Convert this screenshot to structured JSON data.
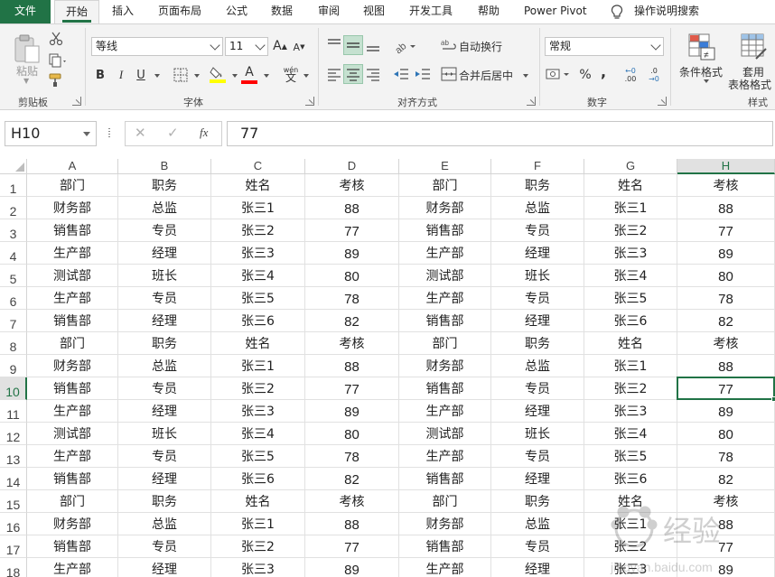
{
  "menu": {
    "tabs": [
      "文件",
      "开始",
      "插入",
      "页面布局",
      "公式",
      "数据",
      "审阅",
      "视图",
      "开发工具",
      "帮助",
      "Power Pivot"
    ],
    "search_label": "操作说明搜索",
    "active_tab": "开始"
  },
  "ribbon": {
    "clipboard": {
      "paste_label": "粘贴",
      "group_label": "剪贴板"
    },
    "font": {
      "font_name": "等线",
      "font_size": "11",
      "bold": "B",
      "italic": "I",
      "underline": "U",
      "font_color_glyph": "A",
      "phonetic_glyph": "wén",
      "phonetic_char": "文",
      "grow_glyph": "A",
      "shrink_glyph": "A",
      "group_label": "字体",
      "highlight_color": "#ffff00",
      "font_color": "#ff0000"
    },
    "alignment": {
      "wrap_text_label": "自动换行",
      "merge_center_label": "合并后居中",
      "group_label": "对齐方式"
    },
    "number": {
      "format": "常规",
      "percent_glyph": "%",
      "comma_glyph": ",",
      "inc_decimal": ".00",
      "dec_decimal": ".0",
      "group_label": "数字"
    },
    "styles": {
      "conditional_format_label": "条件格式",
      "table_format_label_line1": "套用",
      "table_format_label_line2": "表格格式",
      "group_label": "样式"
    }
  },
  "formula_bar": {
    "name_box": "H10",
    "cancel_glyph": "✕",
    "enter_glyph": "✓",
    "fx_glyph": "fx",
    "content": "77"
  },
  "sheet": {
    "columns": [
      "A",
      "B",
      "C",
      "D",
      "E",
      "F",
      "G",
      "H"
    ],
    "active_column": "H",
    "active_row": "10",
    "rows": [
      {
        "num": "1",
        "cells": [
          "部门",
          "职务",
          "姓名",
          "考核",
          "部门",
          "职务",
          "姓名",
          "考核"
        ]
      },
      {
        "num": "2",
        "cells": [
          "财务部",
          "总监",
          "张三1",
          "88",
          "财务部",
          "总监",
          "张三1",
          "88"
        ]
      },
      {
        "num": "3",
        "cells": [
          "销售部",
          "专员",
          "张三2",
          "77",
          "销售部",
          "专员",
          "张三2",
          "77"
        ]
      },
      {
        "num": "4",
        "cells": [
          "生产部",
          "经理",
          "张三3",
          "89",
          "生产部",
          "经理",
          "张三3",
          "89"
        ]
      },
      {
        "num": "5",
        "cells": [
          "测试部",
          "班长",
          "张三4",
          "80",
          "测试部",
          "班长",
          "张三4",
          "80"
        ]
      },
      {
        "num": "6",
        "cells": [
          "生产部",
          "专员",
          "张三5",
          "78",
          "生产部",
          "专员",
          "张三5",
          "78"
        ]
      },
      {
        "num": "7",
        "cells": [
          "销售部",
          "经理",
          "张三6",
          "82",
          "销售部",
          "经理",
          "张三6",
          "82"
        ]
      },
      {
        "num": "8",
        "cells": [
          "部门",
          "职务",
          "姓名",
          "考核",
          "部门",
          "职务",
          "姓名",
          "考核"
        ]
      },
      {
        "num": "9",
        "cells": [
          "财务部",
          "总监",
          "张三1",
          "88",
          "财务部",
          "总监",
          "张三1",
          "88"
        ]
      },
      {
        "num": "10",
        "cells": [
          "销售部",
          "专员",
          "张三2",
          "77",
          "销售部",
          "专员",
          "张三2",
          "77"
        ]
      },
      {
        "num": "11",
        "cells": [
          "生产部",
          "经理",
          "张三3",
          "89",
          "生产部",
          "经理",
          "张三3",
          "89"
        ]
      },
      {
        "num": "12",
        "cells": [
          "测试部",
          "班长",
          "张三4",
          "80",
          "测试部",
          "班长",
          "张三4",
          "80"
        ]
      },
      {
        "num": "13",
        "cells": [
          "生产部",
          "专员",
          "张三5",
          "78",
          "生产部",
          "专员",
          "张三5",
          "78"
        ]
      },
      {
        "num": "14",
        "cells": [
          "销售部",
          "经理",
          "张三6",
          "82",
          "销售部",
          "经理",
          "张三6",
          "82"
        ]
      },
      {
        "num": "15",
        "cells": [
          "部门",
          "职务",
          "姓名",
          "考核",
          "部门",
          "职务",
          "姓名",
          "考核"
        ]
      },
      {
        "num": "16",
        "cells": [
          "财务部",
          "总监",
          "张三1",
          "88",
          "财务部",
          "总监",
          "张三1",
          "88"
        ]
      },
      {
        "num": "17",
        "cells": [
          "销售部",
          "专员",
          "张三2",
          "77",
          "销售部",
          "专员",
          "张三2",
          "77"
        ]
      },
      {
        "num": "18",
        "cells": [
          "生产部",
          "经理",
          "张三3",
          "89",
          "生产部",
          "经理",
          "张三3",
          "89"
        ]
      }
    ]
  },
  "watermark": {
    "brand": "经验",
    "url": "jingyan.baidu.com"
  },
  "colors": {
    "accent": "#217346",
    "selected_button": "#c5e1d0"
  }
}
